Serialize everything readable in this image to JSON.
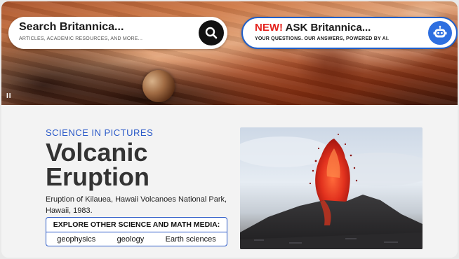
{
  "hero": {
    "pause_symbol": "II",
    "search": {
      "title": "Search Britannica...",
      "subtitle": "ARTICLES, ACADEMIC RESOURCES, AND MORE...",
      "icon": "search-icon"
    },
    "ask": {
      "new_badge": "NEW!",
      "title": "ASK Britannica...",
      "subtitle": "YOUR QUESTIONS. OUR ANSWERS, POWERED BY AI.",
      "icon": "robot-icon"
    }
  },
  "content": {
    "eyebrow": "SCIENCE IN PICTURES",
    "headline": "Volcanic Eruption",
    "caption": "Eruption of Kilauea, Hawaii Volcanoes National Park, Hawaii, 1983.",
    "explore_label": "EXPLORE OTHER SCIENCE AND MATH MEDIA:",
    "explore_links": [
      "geophysics",
      "geology",
      "Earth sciences"
    ]
  },
  "colors": {
    "accent_blue": "#2a59c8",
    "new_red": "#e3211c",
    "bot_blue": "#2e6fe0"
  }
}
